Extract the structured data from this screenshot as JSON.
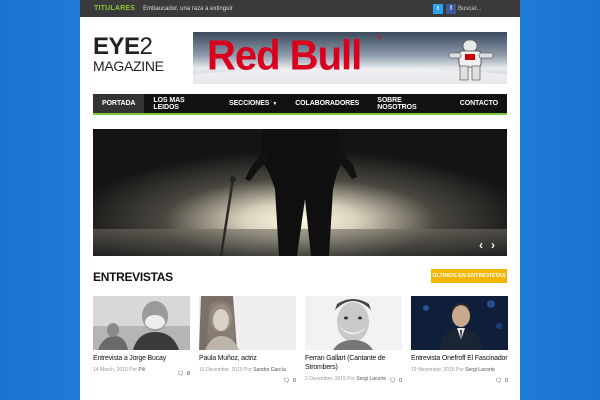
{
  "topbar": {
    "ticker_label": "TITULARES",
    "ticker_text": "Embaucador, una raza a extinguir",
    "twitter_icon": "t",
    "facebook_icon": "f",
    "search_placeholder": "Buscar..."
  },
  "logo": {
    "line1_word": "EYE",
    "line1_number": "2",
    "line2": "MAGAZINE"
  },
  "banner": {
    "brand": "Red Bull",
    "registered": "®"
  },
  "nav": {
    "items": [
      {
        "label": "PORTADA",
        "active": true
      },
      {
        "label": "LOS MAS LEIDOS"
      },
      {
        "label": "SECCIONES",
        "has_dropdown": true
      },
      {
        "label": "COLABORADORES"
      },
      {
        "label": "SOBRE NOSOTROS"
      },
      {
        "label": "CONTACTO"
      }
    ],
    "accent_color": "#7cc63a"
  },
  "hero": {
    "prev_icon": "‹",
    "next_icon": "›"
  },
  "section": {
    "title": "ENTREVISTAS",
    "button_label": "ÚLTIMOS EN ENTREVISTAS",
    "button_color": "#f2b705"
  },
  "cards": [
    {
      "title": "Entrevista a Jorge Bucay",
      "date": "14 March, 2016",
      "by": "Por",
      "author": "Pili",
      "comments": "8"
    },
    {
      "title": "Paula Muñoz, actriz",
      "date": "15 December, 2015",
      "by": "Por",
      "author": "Sandra García",
      "comments": "0"
    },
    {
      "title": "Ferran Gallart (Cantante de Strombers)",
      "date": "2 December, 2015",
      "by": "Por",
      "author": "Sergi Lacorte",
      "comments": "0"
    },
    {
      "title": "Entrevista Onefroff El Fascinador",
      "date": "19 November, 2015",
      "by": "Por",
      "author": "Sergi Lacorte",
      "comments": "0"
    }
  ]
}
